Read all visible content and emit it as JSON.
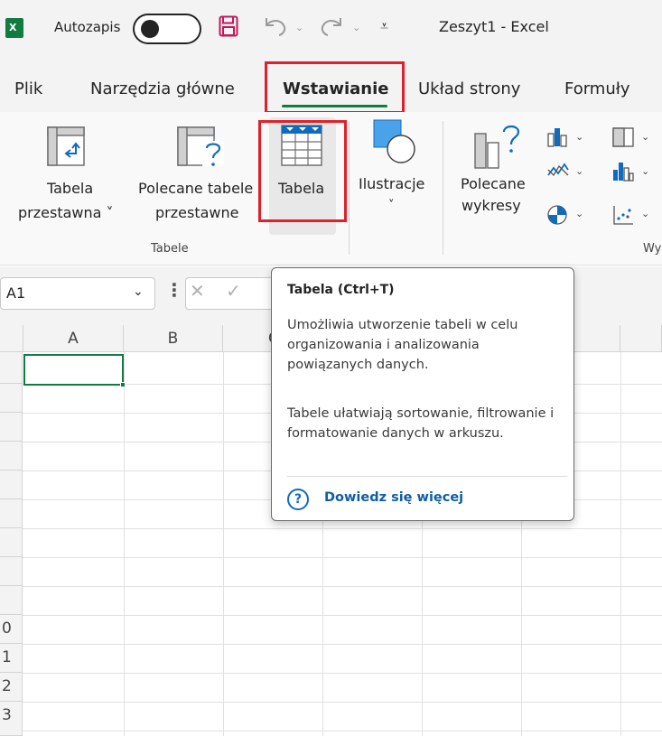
{
  "titlebar": {
    "logo_text": "X",
    "autosave_label": "Autozapis",
    "doc_title": "Zeszyt1  -  Excel"
  },
  "tabs": [
    {
      "label": "Plik"
    },
    {
      "label": "Narzędzia główne"
    },
    {
      "label": "Wstawianie"
    },
    {
      "label": "Układ strony"
    },
    {
      "label": "Formuły"
    }
  ],
  "ribbon": {
    "pivot_table": {
      "line1": "Tabela",
      "line2": "przestawna ˅"
    },
    "recommended_pivot": {
      "line1": "Polecane tabele",
      "line2": "przestawne"
    },
    "table": {
      "label": "Tabela"
    },
    "group_tables": "Tabele",
    "illustrations": {
      "line1": "Ilustracje",
      "line2": "˅"
    },
    "recommended_charts": {
      "line1": "Polecane",
      "line2": "wykresy"
    },
    "group_charts_partial": "Wy"
  },
  "formula_bar": {
    "namebox_value": "A1"
  },
  "grid": {
    "columns": [
      "A",
      "B",
      "C"
    ],
    "rows": [
      "",
      "",
      "",
      "",
      "",
      "",
      "",
      "",
      "",
      "0",
      "1",
      "2",
      "3"
    ]
  },
  "tooltip": {
    "title": "Tabela (Ctrl+T)",
    "paragraph1": "Umożliwia utworzenie tabeli w celu organizowania i analizowania powiązanych danych.",
    "paragraph2": "Tabele ułatwiają sortowanie, filtrowanie i formatowanie danych w arkuszu.",
    "help_icon_text": "?",
    "link": "Dowiedz się więcej"
  },
  "colors": {
    "excel_green": "#107c41",
    "highlight_red": "#e0202a",
    "link_blue": "#115ea3"
  }
}
